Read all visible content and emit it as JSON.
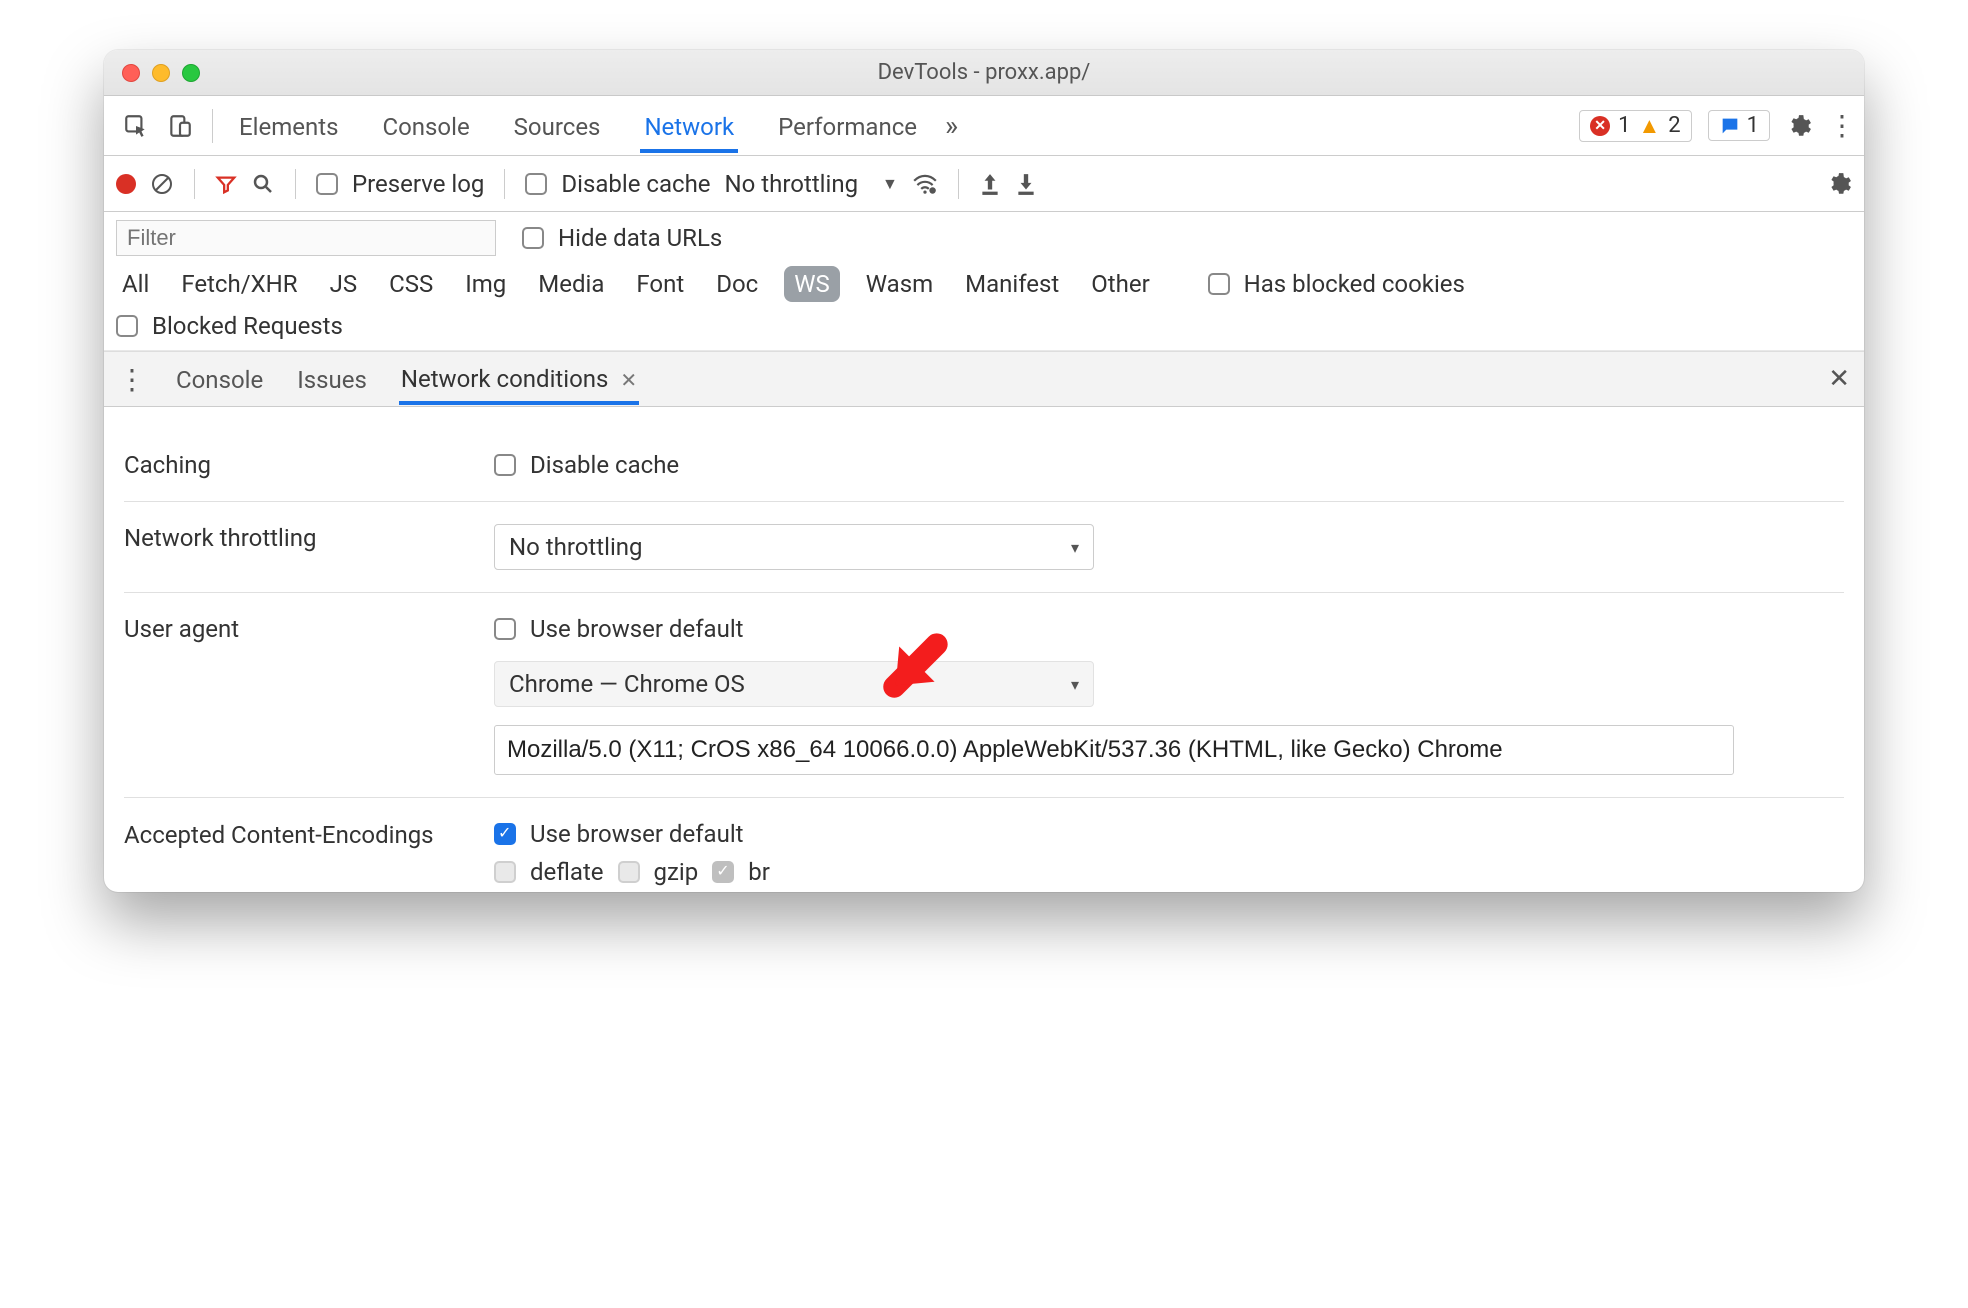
{
  "window": {
    "title": "DevTools - proxx.app/"
  },
  "main_tabs": {
    "items": [
      "Elements",
      "Console",
      "Sources",
      "Network",
      "Performance"
    ],
    "active": "Network",
    "error_count": "1",
    "warn_count": "2",
    "msg_count": "1"
  },
  "net_toolbar": {
    "preserve_log": "Preserve log",
    "disable_cache": "Disable cache",
    "throttling_label": "No throttling"
  },
  "filters": {
    "placeholder": "Filter",
    "hide_data_urls": "Hide data URLs",
    "types": [
      "All",
      "Fetch/XHR",
      "JS",
      "CSS",
      "Img",
      "Media",
      "Font",
      "Doc",
      "WS",
      "Wasm",
      "Manifest",
      "Other"
    ],
    "selected_type": "WS",
    "has_blocked_cookies": "Has blocked cookies",
    "blocked_requests": "Blocked Requests"
  },
  "drawer": {
    "tabs": [
      "Console",
      "Issues",
      "Network conditions"
    ],
    "active": "Network conditions"
  },
  "conditions": {
    "caching_label": "Caching",
    "caching_disable": "Disable cache",
    "throttling_label": "Network throttling",
    "throttling_value": "No throttling",
    "ua_label": "User agent",
    "ua_use_default": "Use browser default",
    "ua_select_value": "Chrome — Chrome OS",
    "ua_string": "Mozilla/5.0 (X11; CrOS x86_64 10066.0.0) AppleWebKit/537.36 (KHTML, like Gecko) Chrome",
    "encodings_label": "Accepted Content-Encodings",
    "encodings_use_default": "Use browser default",
    "enc_deflate": "deflate",
    "enc_gzip": "gzip",
    "enc_br": "br"
  }
}
